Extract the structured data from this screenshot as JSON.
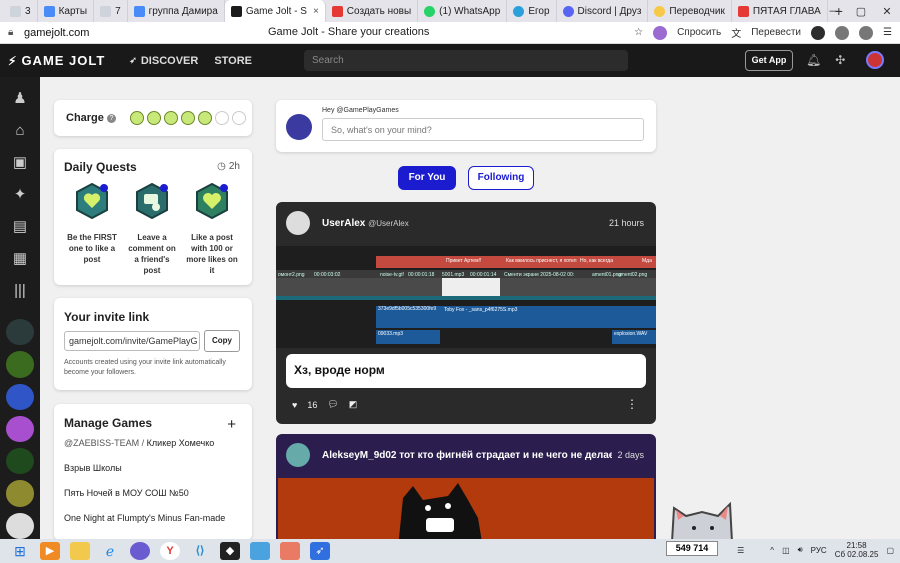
{
  "browser": {
    "tabs": [
      {
        "label": "3",
        "icon": "num-badge-icon",
        "fav": "num"
      },
      {
        "label": "Карты",
        "icon": "maps-icon",
        "fav": "mail"
      },
      {
        "label": "7",
        "icon": "num-badge-icon",
        "fav": "num"
      },
      {
        "label": "группа Дамира",
        "icon": "vk-icon",
        "fav": "mail"
      },
      {
        "label": "Game Jolt - S",
        "icon": "gamejolt-icon",
        "fav": "dark",
        "active": true
      },
      {
        "label": "Создать новы",
        "icon": "mail-icon",
        "fav": "red"
      },
      {
        "label": "(1) WhatsApp",
        "icon": "whatsapp-icon",
        "fav": "green"
      },
      {
        "label": "Егор",
        "icon": "telegram-icon",
        "fav": "blue"
      },
      {
        "label": "Discord | Друз",
        "icon": "discord-icon",
        "fav": "discord"
      },
      {
        "label": "Переводчик",
        "icon": "translate-icon",
        "fav": "yellow"
      },
      {
        "label": "ПЯТАЯ ГЛАВА",
        "icon": "red-book-icon",
        "fav": "red"
      }
    ],
    "new_tab": "+",
    "url": "gamejolt.com",
    "page_title": "Game Jolt - Share your creations",
    "ask_label": "Спросить",
    "translate_label": "Перевести"
  },
  "gj": {
    "logo": "GAME JOLT",
    "discover": "DISCOVER",
    "store": "STORE",
    "search_placeholder": "Search",
    "get_app": "Get App"
  },
  "charge": {
    "label": "Charge",
    "help": "?",
    "full": 5,
    "total": 7
  },
  "quests": {
    "title": "Daily Quests",
    "timer": "2h",
    "items": [
      {
        "text": "Be the FIRST one to like a post",
        "color": "#2e7d7d"
      },
      {
        "text": "Leave a comment on a friend's post",
        "color": "#2b6c6c"
      },
      {
        "text": "Like a post with 100 or more likes on it",
        "color": "#2e8060"
      }
    ]
  },
  "invite": {
    "title": "Your invite link",
    "link": "gamejolt.com/invite/GamePlayG",
    "copy": "Copy",
    "note": "Accounts created using your invite link automatically become your followers."
  },
  "manage": {
    "title": "Manage Games",
    "plus": "+",
    "team": "@ZAEBISS-TEAM",
    "sep": " / ",
    "team_game": "Кликер Хомечко",
    "games": [
      "Взрыв Школы",
      "Пять Ночей в МОУ СОШ №50",
      "One Night at Flumpty's Minus Fan-made"
    ]
  },
  "composer": {
    "hey": "Hey @GamePlayGames",
    "placeholder": "So, what's on your mind?"
  },
  "feed": {
    "for_you": "For You",
    "following": "Following"
  },
  "post1": {
    "user": "UserAlex",
    "handle": "@UserAlex",
    "time": "21 hours",
    "text": "Хз, вроде норм",
    "likes": "16",
    "tracks": {
      "t1": "омонт2.png",
      "t2": "00:00:03:02",
      "t3": "noise-tv.gif",
      "t4": "00:00:01:18",
      "t5": "5001.mp3",
      "t6": "00:00:01:14",
      "c1": "Привет Артем!!",
      "c2": "Как вжилось приснест, я хотел",
      "c3": "Но, как всегда",
      "c4": "Мда",
      "c5": "Сменти экране 2025-08-02 00:",
      "c6": "ament01.png",
      "c7": "ament02.png",
      "a1": "373e9df5b005c535300fe9",
      "a2": "Toby Fox - _sans_p4f6275S.mp3",
      "a3": "09033.mp3",
      "a4": "explosion.WAV"
    }
  },
  "post2": {
    "user": "AlekseyM_9d02",
    "title": "тот кто фигнёй страдает и не чего не делает (sus...",
    "time": "2 days"
  },
  "taskbar": {
    "counter": "549 714",
    "lang": "РУС",
    "time": "21:58",
    "date": "Сб 02.08.25"
  }
}
